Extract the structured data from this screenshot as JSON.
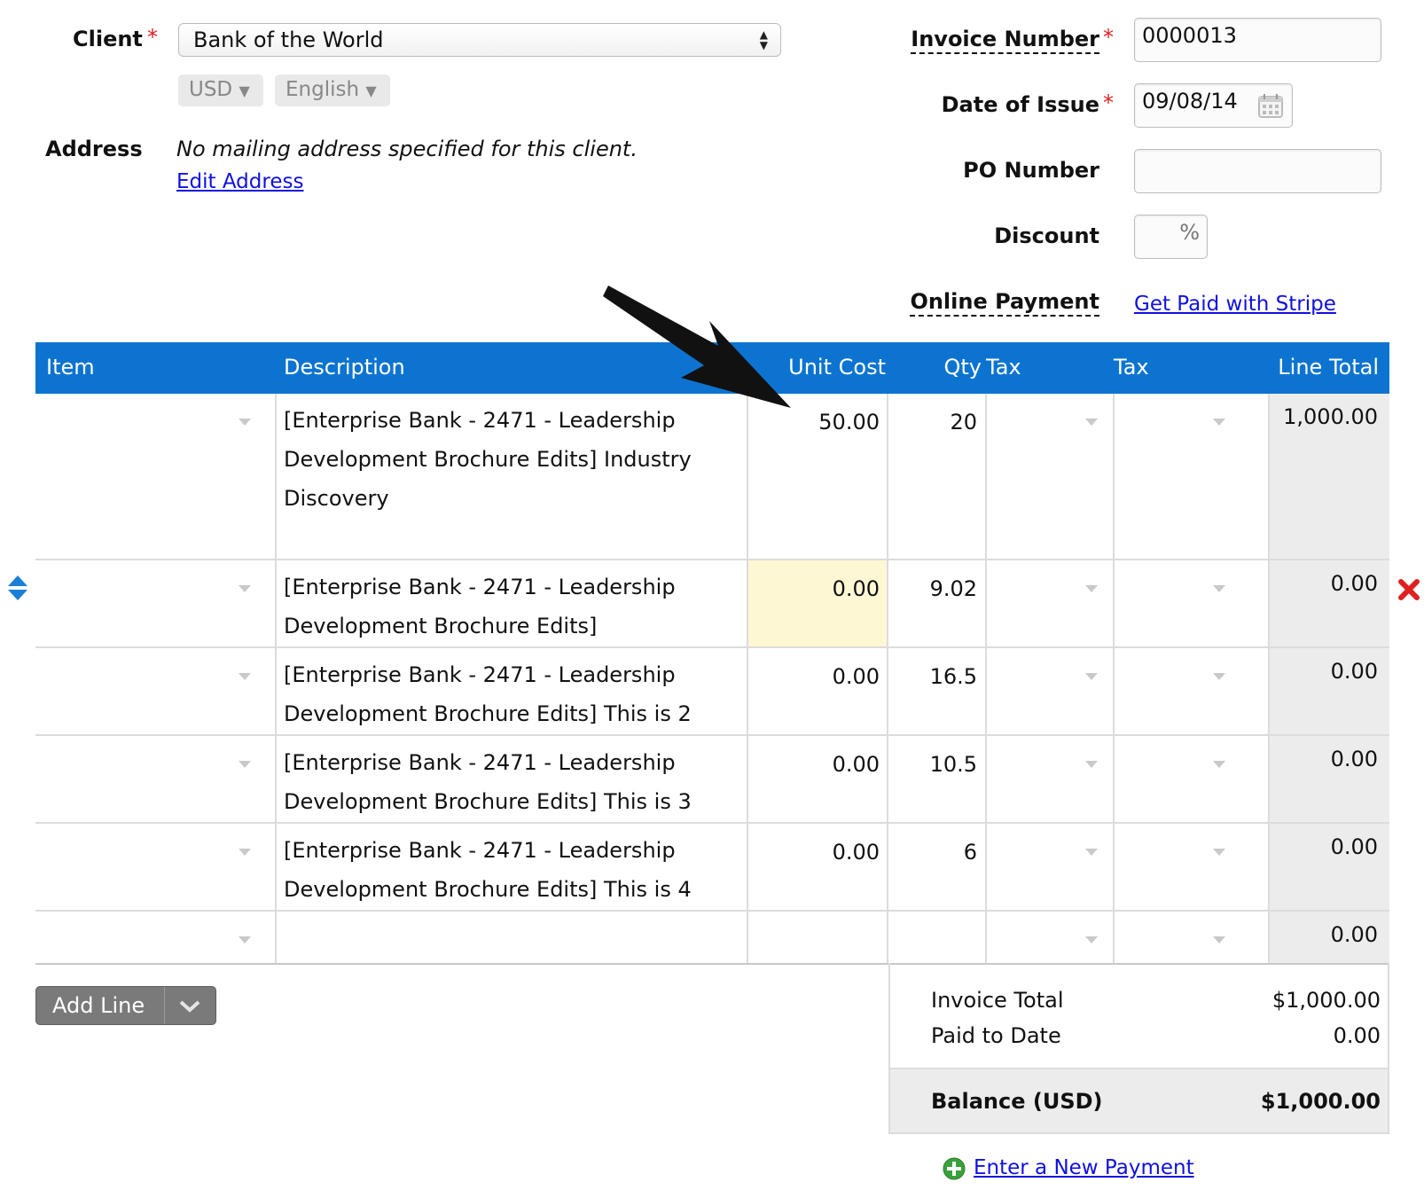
{
  "client": {
    "label": "Client",
    "required_mark": "*",
    "selected": "Bank of the World",
    "currency": "USD",
    "language": "English",
    "address_label": "Address",
    "address_text": "No mailing address specified for this client.",
    "edit_address": "Edit Address"
  },
  "meta": {
    "invoice_number_label": "Invoice Number",
    "invoice_number_value": "0000013",
    "date_label": "Date of Issue",
    "date_value": "09/08/14",
    "po_label": "PO Number",
    "po_value": "",
    "discount_label": "Discount",
    "discount_suffix": "%",
    "online_payment_label": "Online Payment",
    "stripe_link": "Get Paid with Stripe"
  },
  "table": {
    "headers": [
      "Item",
      "Description",
      "Unit Cost",
      "Qty",
      "Tax",
      "Tax",
      "Line Total"
    ],
    "rows": [
      {
        "description": [
          "[Enterprise Bank - 2471 - Leadership",
          "Development Brochure Edits]  Industry",
          "Discovery"
        ],
        "unit_cost": "50.00",
        "qty": "20",
        "line_total": "1,000.00"
      },
      {
        "description": [
          "[Enterprise Bank - 2471 - Leadership",
          "Development Brochure Edits]"
        ],
        "unit_cost": "0.00",
        "qty": "9.02",
        "line_total": "0.00"
      },
      {
        "description": [
          "[Enterprise Bank - 2471 - Leadership",
          "Development Brochure Edits]  This is 2"
        ],
        "unit_cost": "0.00",
        "qty": "16.5",
        "line_total": "0.00"
      },
      {
        "description": [
          "[Enterprise Bank - 2471 - Leadership",
          "Development Brochure Edits]  This is 3"
        ],
        "unit_cost": "0.00",
        "qty": "10.5",
        "line_total": "0.00"
      },
      {
        "description": [
          "[Enterprise Bank - 2471 - Leadership",
          "Development Brochure Edits]  This is 4"
        ],
        "unit_cost": "0.00",
        "qty": "6",
        "line_total": "0.00"
      },
      {
        "description": [
          ""
        ],
        "unit_cost": "",
        "qty": "",
        "line_total": "0.00"
      }
    ]
  },
  "actions": {
    "add_line": "Add Line",
    "enter_payment": "Enter a New Payment"
  },
  "totals": {
    "invoice_total_label": "Invoice Total",
    "invoice_total_value": "$1,000.00",
    "paid_label": "Paid to Date",
    "paid_value": "0.00",
    "balance_label": "Balance (USD)",
    "balance_value": "$1,000.00"
  },
  "colors": {
    "header_bg": "#0c74d0",
    "highlight_cell": "#fdf7d4",
    "required": "#e02020",
    "delete": "#e02020",
    "link": "#1010e0"
  }
}
